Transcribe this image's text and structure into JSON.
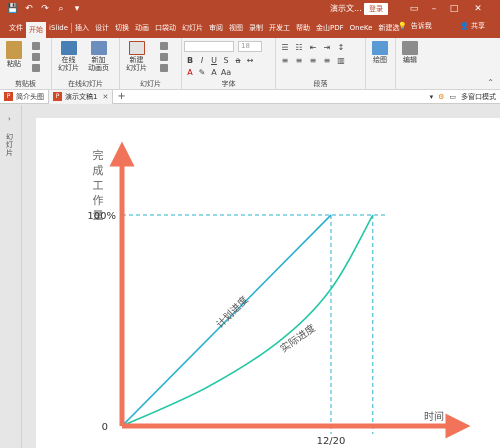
{
  "titlebar": {
    "title": "演示文...",
    "login": "登录"
  },
  "tabs": [
    "文件",
    "开始",
    "iSlide",
    "插入",
    "设计",
    "切换",
    "动画",
    "口袋动",
    "幻灯片",
    "审阅",
    "视图",
    "录制",
    "开发工",
    "帮助",
    "金山PDF",
    "OneKe",
    "新建选"
  ],
  "help": "告诉我",
  "share": "共享",
  "ribbon": {
    "paste": "粘贴",
    "clipboard": "剪贴板",
    "online_slides": "在线\n幻灯片",
    "new_anim_page": "新加\n动画页",
    "online_group": "在线幻灯片",
    "new_slide": "新建\n幻灯片",
    "slides_group": "幻灯片",
    "font_size": "18",
    "font_group": "字体",
    "para_group": "段落",
    "drawing": "绘图",
    "editing": "编辑"
  },
  "doctabs": [
    {
      "label": "简介头图",
      "active": false
    },
    {
      "label": "演示文稿1",
      "active": true
    }
  ],
  "right_tools": {
    "multi_window": "多窗口模式"
  },
  "leftpane": {
    "label": "幻灯片"
  },
  "chart_data": {
    "type": "line",
    "ylabel": "完成工作量",
    "xlabel": "时间",
    "y_ticks": [
      "0",
      "100%"
    ],
    "x_ticks": [
      "12/20"
    ],
    "series": [
      {
        "name": "计划进度",
        "points": [
          [
            0,
            0
          ],
          [
            1,
            100
          ]
        ],
        "color": "#2ab0cf"
      },
      {
        "name": "实际进度",
        "points": [
          [
            0,
            0
          ],
          [
            0.4,
            18
          ],
          [
            0.75,
            40
          ],
          [
            1.0,
            65
          ],
          [
            1.2,
            100
          ]
        ],
        "color": "#22c7a4"
      }
    ],
    "axis_color": "#f0735a"
  }
}
